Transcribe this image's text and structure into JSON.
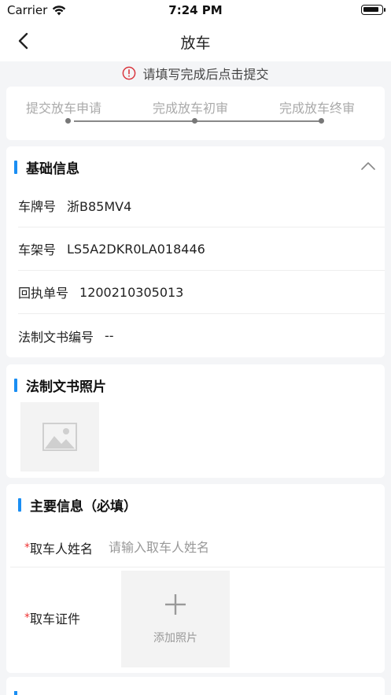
{
  "status_bar": {
    "carrier": "Carrier",
    "time": "7:24 PM"
  },
  "nav": {
    "title": "放车"
  },
  "notice": {
    "text": "请填写完成后点击提交"
  },
  "steps": [
    {
      "label": "提交放车申请"
    },
    {
      "label": "完成放车初审"
    },
    {
      "label": "完成放车终审"
    }
  ],
  "basic_info": {
    "title": "基础信息",
    "rows": [
      {
        "label": "车牌号",
        "value": "浙B85MV4"
      },
      {
        "label": "车架号",
        "value": "LS5A2DKR0LA018446"
      },
      {
        "label": "回执单号",
        "value": "1200210305013"
      },
      {
        "label": "法制文书编号",
        "value": "--"
      }
    ]
  },
  "legal_photo": {
    "title": "法制文书照片"
  },
  "main_info": {
    "title": "主要信息（必填）",
    "name_label": "取车人姓名",
    "name_placeholder": "请输入取车人姓名",
    "id_label": "取车证件",
    "upload_label": "添加照片",
    "required_mark": "*"
  },
  "colors": {
    "accent": "#1a8ef3",
    "required": "#e33333",
    "notice_icon": "#d9363e"
  }
}
